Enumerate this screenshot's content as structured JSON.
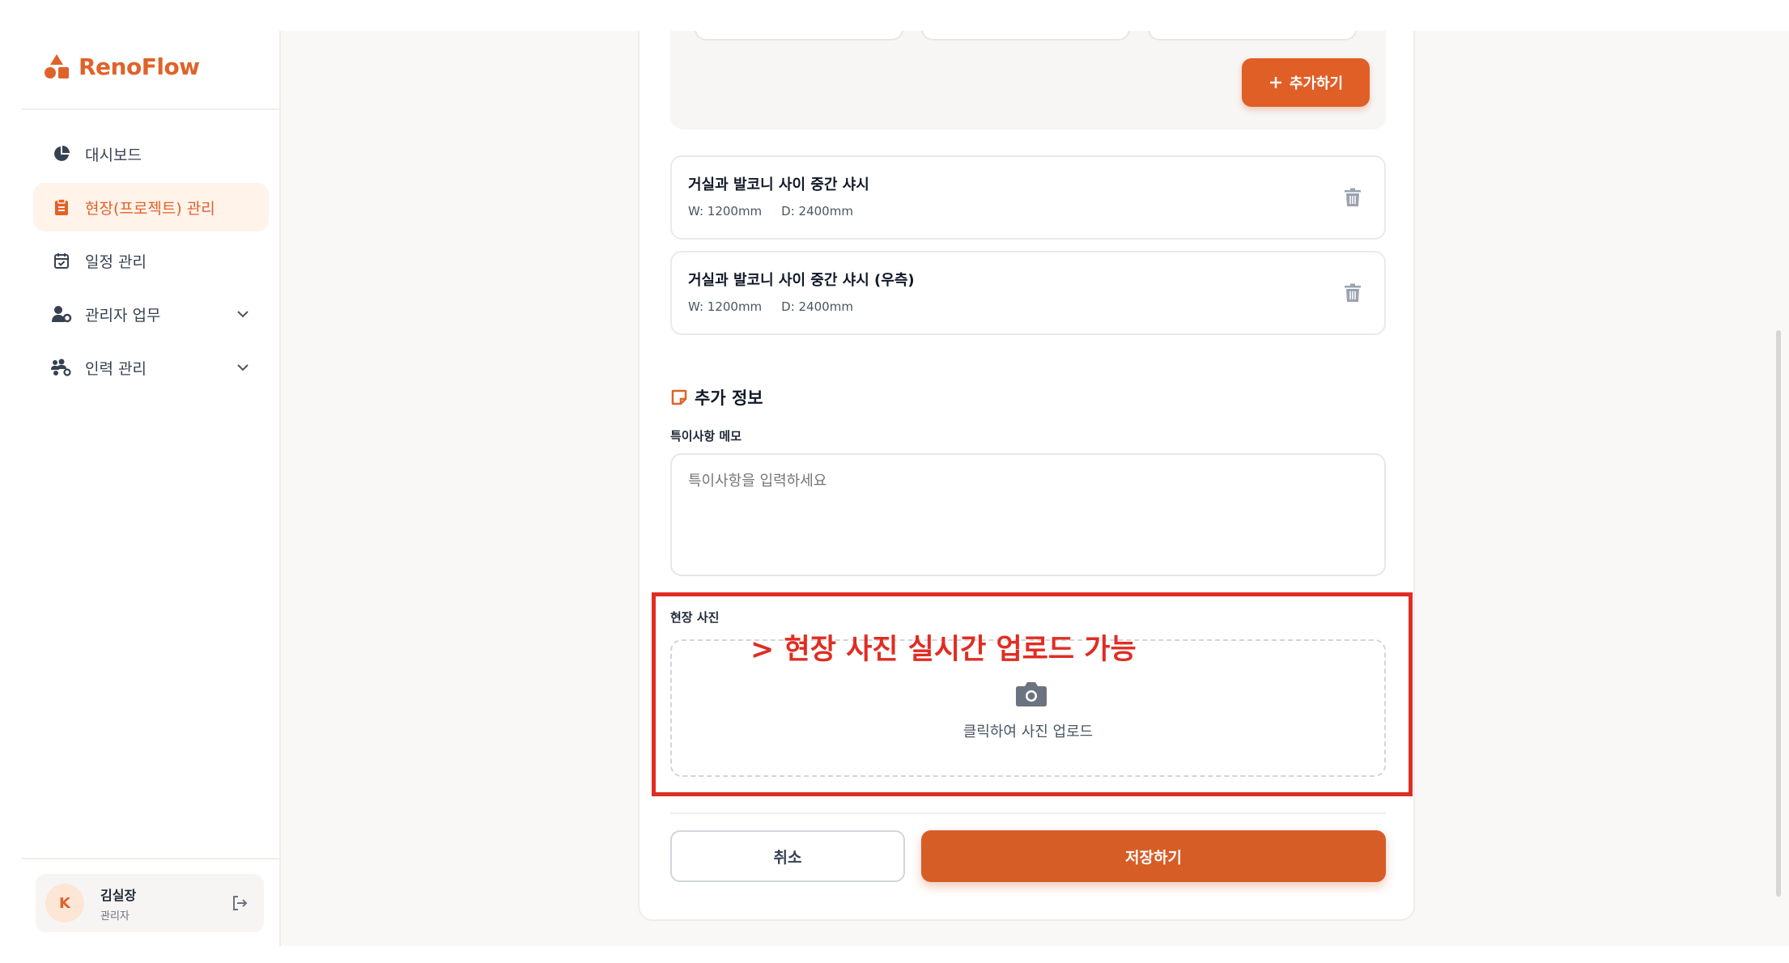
{
  "brand": {
    "name": "RenoFlow",
    "accent": "#e0622a"
  },
  "sidebar": {
    "items": [
      {
        "label": "대시보드",
        "icon": "pie-chart-icon"
      },
      {
        "label": "현장(프로젝트) 관리",
        "icon": "clipboard-icon",
        "active": true
      },
      {
        "label": "일정 관리",
        "icon": "calendar-check-icon"
      },
      {
        "label": "관리자 업무",
        "icon": "user-settings-icon",
        "expandable": true
      },
      {
        "label": "인력 관리",
        "icon": "users-settings-icon",
        "expandable": true
      }
    ]
  },
  "user": {
    "initial": "K",
    "name": "김실장",
    "role": "관리자"
  },
  "form": {
    "add_button": "추가하기",
    "items": [
      {
        "title": "거실과 발코니 사이 중간 샤시",
        "width": "W: 1200mm",
        "depth": "D: 2400mm"
      },
      {
        "title": "거실과 발코니 사이 중간 샤시 (우측)",
        "width": "W: 1200mm",
        "depth": "D: 2400mm"
      }
    ],
    "extra_section_title": "추가 정보",
    "memo_label": "특이사항 메모",
    "memo_placeholder": "특이사항을 입력하세요",
    "photo_label": "현장 사진",
    "upload_text": "클릭하여 사진 업로드",
    "cancel": "취소",
    "save": "저장하기"
  },
  "annotation": {
    "text": "> 현장 사진 실시간 업로드 가능",
    "color": "#e02d22"
  }
}
